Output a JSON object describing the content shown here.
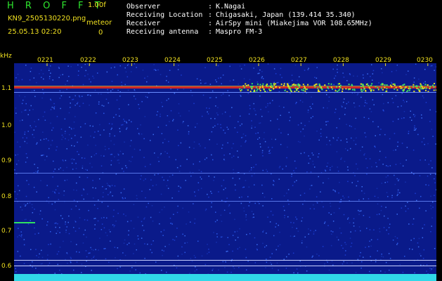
{
  "app": {
    "logo": "H R O F F T",
    "version": "1.00f",
    "filename": "KN9_2505130220.png",
    "timestamp": "25.05.13 02:20",
    "meteor_label": "meteor",
    "meteor_count": "0"
  },
  "info": [
    {
      "label": "Observer",
      "value": "K.Nagai"
    },
    {
      "label": "Receiving Location",
      "value": "Chigasaki, Japan (139.414 35.340)"
    },
    {
      "label": "Receiver",
      "value": "AirSpy mini (Miakejima VOR 108.65MHz)"
    },
    {
      "label": "Receiving antenna",
      "value": "Maspro FM-3"
    }
  ],
  "chart_data": {
    "type": "heatmap",
    "yunit": "kHz",
    "yticks": [
      "1.1",
      "1.0",
      "0.9",
      "0.8",
      "0.7",
      "0.6"
    ],
    "xticks": [
      "0221",
      "0222",
      "0223",
      "0224",
      "0225",
      "0226",
      "0227",
      "0228",
      "0229",
      "0230"
    ],
    "colors": {
      "background": "#0a1a8a",
      "text": "#f0e020",
      "signal": "#ff3030",
      "logo": "#2ee62e"
    }
  }
}
